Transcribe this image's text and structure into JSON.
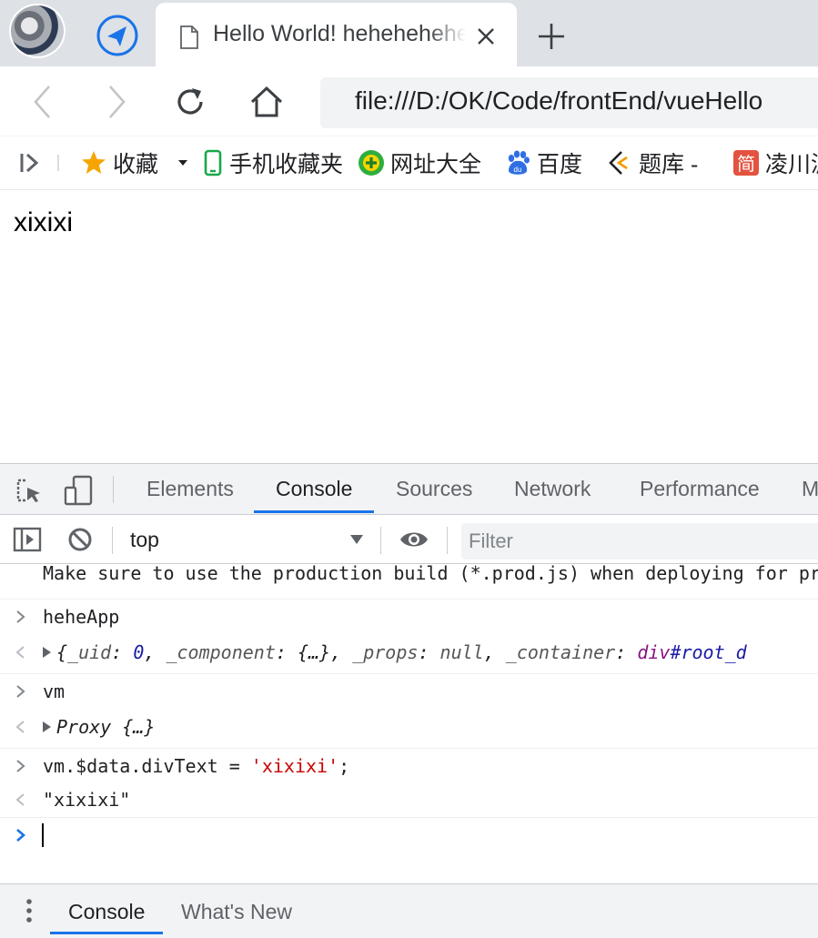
{
  "browser": {
    "tab_title": "Hello World! hehehehehe",
    "url": "file:///D:/OK/Code/frontEnd/vueHello"
  },
  "bookmarks": [
    {
      "label": "收藏",
      "icon": "star-icon"
    },
    {
      "label": "手机收藏夹",
      "icon": "phone-icon"
    },
    {
      "label": "网址大全",
      "icon": "plus-circle-icon"
    },
    {
      "label": "百度",
      "icon": "baidu-paw-icon"
    },
    {
      "label": "题库 -",
      "icon": "tiku-icon"
    },
    {
      "label": "凌川派",
      "icon": "jian-icon"
    }
  ],
  "page": {
    "text": "xixixi"
  },
  "devtools": {
    "tabs": [
      "Elements",
      "Console",
      "Sources",
      "Network",
      "Performance",
      "M"
    ],
    "active_tab": "Console",
    "context": "top",
    "filter_placeholder": "Filter",
    "console": {
      "truncated_line": "Make sure to use the production build (*.prod.js) when deploying for production.",
      "line1_input": "heheApp",
      "line1_output": {
        "open": "{",
        "k1": "_uid",
        "v1": "0",
        "k2": "_component",
        "v2": "{…}",
        "k3": "_props",
        "v3": "null",
        "k4": "_container",
        "v4_tag": "div",
        "v4_id": "#root_d"
      },
      "line2_input": "vm",
      "line2_output": "Proxy {…}",
      "line3_input_code": "vm.$data.divText = ",
      "line3_input_string": "'xixixi'",
      "line3_input_end": ";",
      "line3_output": "\"xixixi\""
    },
    "drawer_tabs": [
      "Console",
      "What's New"
    ]
  },
  "colors": {
    "accent": "#1a73e8",
    "string": "#c80000",
    "number": "#1a1aa6",
    "tag": "#881280"
  }
}
